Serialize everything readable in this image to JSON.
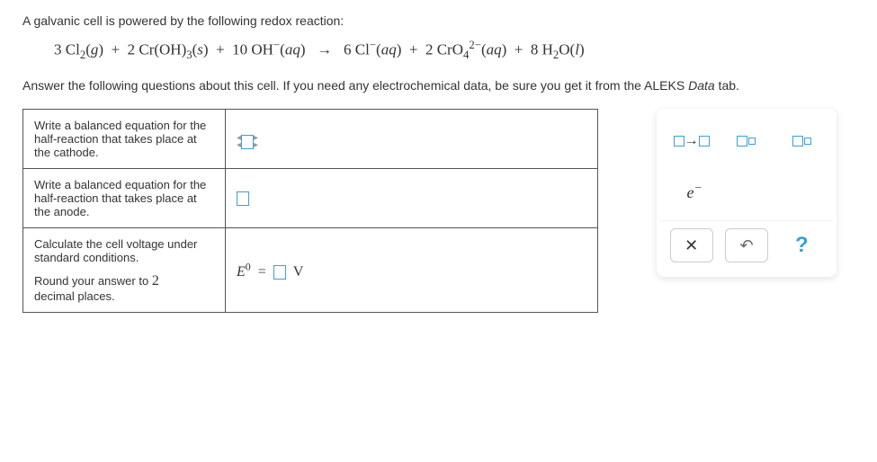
{
  "intro": "A galvanic cell is powered by the following redox reaction:",
  "equation_html": "3 Cl<span class='sub'>2</span>(<i>g</i>) &nbsp;+&nbsp; 2 Cr(OH)<span class='sub'>3</span>(<i>s</i>) &nbsp;+&nbsp; 10 OH<span class='sup'>&minus;</span>(<i>aq</i>) &nbsp;&nbsp;&rarr;&nbsp;&nbsp; 6 Cl<span class='sup'>&minus;</span>(<i>aq</i>) &nbsp;+&nbsp; 2 CrO<span class='sub'>4</span><span class='sup'>2&minus;</span>(<i>aq</i>) &nbsp;+&nbsp; 8 H<span class='sub'>2</span>O(<i>l</i>)",
  "instructions_prefix": "Answer the following questions about this cell. If you need any electrochemical data, be sure you get it from the ALEKS ",
  "data_word": "Data",
  "instructions_suffix": " tab.",
  "row1_prompt": "Write a balanced equation for the half-reaction that takes place at the cathode.",
  "row2_prompt": "Write a balanced equation for the half-reaction that takes place at the anode.",
  "row3_prompt_line1": "Calculate the cell voltage under standard conditions.",
  "row3_prompt_line2": "Round your answer to",
  "row3_places": "2",
  "row3_prompt_line3": "decimal places.",
  "voltage_label_prefix": "E",
  "voltage_super": "0",
  "voltage_equals": "=",
  "voltage_unit": "V",
  "tool_arrow": "→",
  "tool_electron": "e",
  "tool_electron_sup": "−",
  "btn_clear": "✕",
  "btn_reset": "↶",
  "btn_help": "?"
}
